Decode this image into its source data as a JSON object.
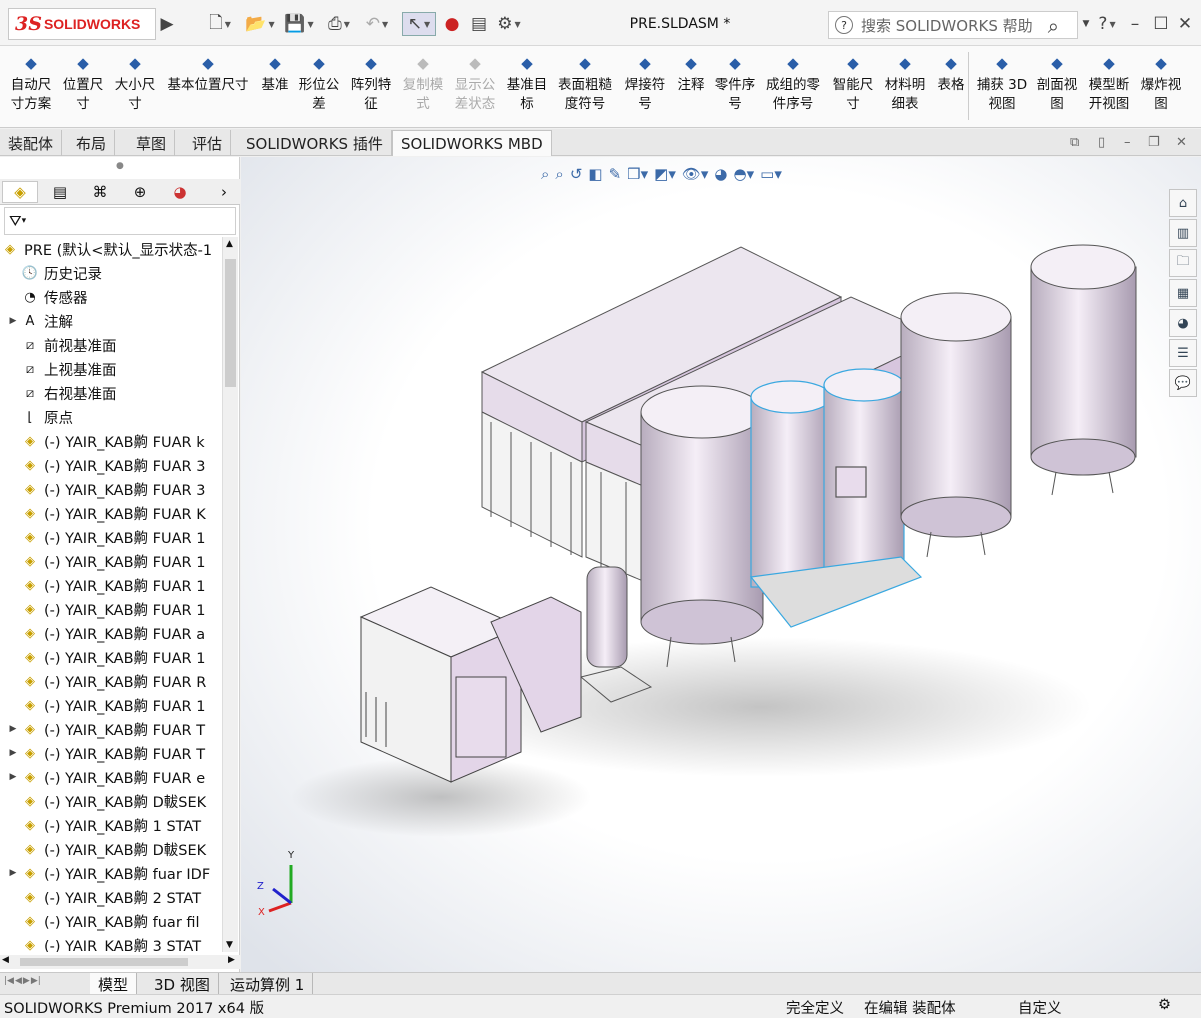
{
  "app": {
    "logo_ds": "3S",
    "logo_text": "SOLIDWORKS",
    "doc_title": "PRE.SLDASM *"
  },
  "search": {
    "placeholder": "搜索 SOLIDWORKS 帮助"
  },
  "help_label": "?",
  "ribbon": [
    {
      "label": "自动尺\n寸方案",
      "icon": "auto-dimension-icon",
      "enabled": true
    },
    {
      "label": "位置尺\n寸",
      "icon": "location-dimension-icon",
      "enabled": true
    },
    {
      "label": "大小尺\n寸",
      "icon": "size-dimension-icon",
      "enabled": true
    },
    {
      "label": "基本位置尺寸",
      "icon": "basic-location-dimension-icon",
      "enabled": true
    },
    {
      "label": "基准",
      "icon": "datum-icon",
      "enabled": true
    },
    {
      "label": "形位公\n差",
      "icon": "geometric-tolerance-icon",
      "enabled": true
    },
    {
      "label": "阵列特\n征",
      "icon": "pattern-feature-icon",
      "enabled": true
    },
    {
      "label": "复制模\n式",
      "icon": "copy-scheme-icon",
      "enabled": false
    },
    {
      "label": "显示公\n差状态",
      "icon": "show-tolerance-status-icon",
      "enabled": false
    },
    {
      "label": "基准目\n标",
      "icon": "datum-target-icon",
      "enabled": true
    },
    {
      "label": "表面粗糙\n度符号",
      "icon": "surface-finish-icon",
      "enabled": true
    },
    {
      "label": "焊接符\n号",
      "icon": "weld-symbol-icon",
      "enabled": true
    },
    {
      "label": "注释",
      "icon": "note-icon",
      "enabled": true
    },
    {
      "label": "零件序\n号",
      "icon": "balloon-icon",
      "enabled": true
    },
    {
      "label": "成组的零\n件序号",
      "icon": "stacked-balloon-icon",
      "enabled": true
    },
    {
      "label": "智能尺\n寸",
      "icon": "smart-dimension-icon",
      "enabled": true
    },
    {
      "label": "材料明\n细表",
      "icon": "bom-icon",
      "enabled": true
    },
    {
      "label": "表格",
      "icon": "table-icon",
      "enabled": true
    },
    {
      "label": "捕获 3D\n视图",
      "icon": "capture-3d-view-icon",
      "enabled": true
    },
    {
      "label": "剖面视\n图",
      "icon": "section-view-icon",
      "enabled": true
    },
    {
      "label": "模型断\n开视图",
      "icon": "model-break-view-icon",
      "enabled": true
    },
    {
      "label": "爆炸视\n图",
      "icon": "exploded-view-icon",
      "enabled": true
    }
  ],
  "cmd_tabs": [
    "装配体",
    "布局",
    "草图",
    "评估",
    "SOLIDWORKS 插件",
    "SOLIDWORKS MBD"
  ],
  "active_cmd_tab": "SOLIDWORKS MBD",
  "tree": {
    "root": "PRE  (默认<默认_显示状态-1",
    "items": [
      {
        "label": "历史记录",
        "icon": "history-icon",
        "expand": false
      },
      {
        "label": "传感器",
        "icon": "sensor-icon",
        "expand": false
      },
      {
        "label": "注解",
        "icon": "annotation-icon",
        "expand": true
      },
      {
        "label": "前视基准面",
        "icon": "plane-icon",
        "expand": false
      },
      {
        "label": "上视基准面",
        "icon": "plane-icon",
        "expand": false
      },
      {
        "label": "右视基准面",
        "icon": "plane-icon",
        "expand": false
      },
      {
        "label": "原点",
        "icon": "origin-icon",
        "expand": false
      },
      {
        "label": "(-) YAIR_KAB齁  FUAR  k",
        "icon": "part-icon",
        "expand": false
      },
      {
        "label": "(-) YAIR_KAB齁  FUAR  3",
        "icon": "part-icon",
        "expand": false
      },
      {
        "label": "(-) YAIR_KAB齁   FUAR  3",
        "icon": "part-icon",
        "expand": false
      },
      {
        "label": "(-) YAIR_KAB齁  FUAR  K",
        "icon": "part-icon",
        "expand": false
      },
      {
        "label": "(-) YAIR_KAB齁   FUAR  1",
        "icon": "part-icon",
        "expand": false
      },
      {
        "label": "(-) YAIR_KAB齁   FUAR  1",
        "icon": "part-icon",
        "expand": false
      },
      {
        "label": "(-) YAIR_KAB齁   FUAR  1",
        "icon": "part-icon",
        "expand": false
      },
      {
        "label": "(-) YAIR_KAB齁   FUAR  1",
        "icon": "part-icon",
        "expand": false
      },
      {
        "label": "(-) YAIR_KAB齁   FUAR  a",
        "icon": "part-icon",
        "expand": false
      },
      {
        "label": "(-) YAIR_KAB齁   FUAR  1",
        "icon": "part-icon",
        "expand": false
      },
      {
        "label": "(-) YAIR_KAB齁  FUAR  R",
        "icon": "part-icon",
        "expand": false
      },
      {
        "label": "(-) YAIR_KAB齁   FUAR  1",
        "icon": "part-icon",
        "expand": false
      },
      {
        "label": "(-) YAIR_KAB齁  FUAR  T",
        "icon": "part-icon",
        "expand": true
      },
      {
        "label": "(-) YAIR_KAB齁  FUAR  T",
        "icon": "part-icon",
        "expand": true
      },
      {
        "label": "(-) YAIR_KAB齁  FUAR  e",
        "icon": "part-icon",
        "expand": true
      },
      {
        "label": "(-) YAIR_KAB齁  D軷SEK",
        "icon": "part-icon",
        "expand": false
      },
      {
        "label": "(-) YAIR_KAB齁 1   STAT",
        "icon": "part-icon",
        "expand": false
      },
      {
        "label": "(-) YAIR_KAB齁  D軷SEK",
        "icon": "part-icon",
        "expand": false
      },
      {
        "label": "(-) YAIR_KAB齁  fuar  IDF",
        "icon": "part-icon",
        "expand": true
      },
      {
        "label": "(-) YAIR_KAB齁  2  STAT",
        "icon": "part-icon",
        "expand": false
      },
      {
        "label": "(-) YAIR_KAB齁  fuar   fil",
        "icon": "part-icon",
        "expand": false
      },
      {
        "label": "(-) YAIR_KAB齁  3  STAT",
        "icon": "part-icon",
        "expand": false
      }
    ]
  },
  "bottom_tabs": [
    "模型",
    "3D 视图",
    "运动算例 1"
  ],
  "active_bottom_tab": "模型",
  "status": {
    "product": "SOLIDWORKS Premium 2017 x64 版",
    "definition": "完全定义",
    "mode": "在编辑 装配体",
    "units": "自定义"
  },
  "triad": {
    "x": "X",
    "y": "Y",
    "z": "Z"
  },
  "colors": {
    "accent": "#2a5ea8",
    "model_tint": "#e3d5e8",
    "logo_red": "#d22222"
  }
}
